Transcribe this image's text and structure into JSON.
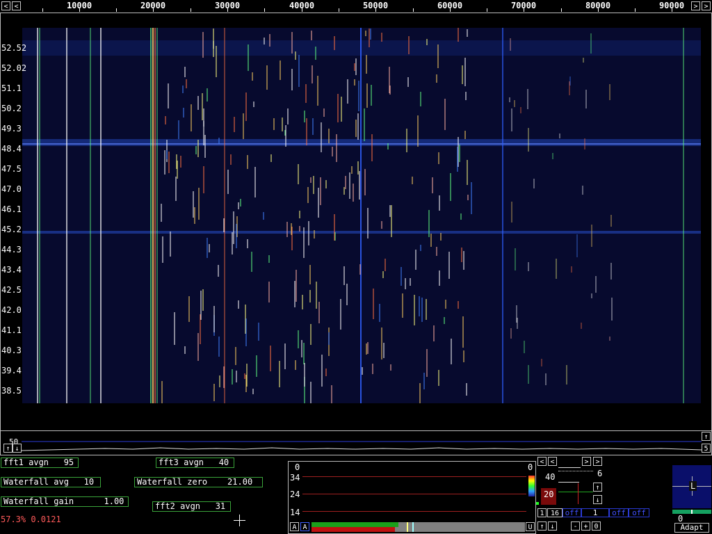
{
  "freq_axis": {
    "ticks": [
      "10000",
      "20000",
      "30000",
      "40000",
      "50000",
      "60000",
      "70000",
      "80000",
      "90000"
    ],
    "left_arrow": "<",
    "right_arrow": ">",
    "far_left_arrow": "<",
    "far_right_arrow": ">"
  },
  "waterfall": {
    "time_labels": [
      "52.52",
      "52.02",
      "51.1",
      "50.2",
      "49.3",
      "48.4",
      "47.5",
      "47.0",
      "46.1",
      "45.2",
      "44.3",
      "43.4",
      "42.5",
      "42.0",
      "41.1",
      "40.3",
      "39.4",
      "38.5"
    ],
    "colors": {
      "background": "#070a2e",
      "band": "#1f3fa8"
    }
  },
  "spectrum": {
    "level_label": "50",
    "up_arrow": "↑",
    "down_arrow": "↓",
    "right_value": "5"
  },
  "params": {
    "fft1_avgn": "fft1 avgn   95",
    "fft3_avgn": "fft3 avgn   40",
    "waterfall_avg": "Waterfall avg   10",
    "waterfall_zero": "Waterfall zero    21.00",
    "waterfall_gain": "Waterfall gain      1.00",
    "fft2_avgn": "fft2 avgn   31",
    "status": "57.3% 0.0121"
  },
  "smeter": {
    "top_left": "0",
    "top_right": "0",
    "levels": [
      "34",
      "24",
      "14"
    ],
    "btn_a1": "A",
    "btn_a2": "A",
    "btn_u": "U"
  },
  "control": {
    "left_arrow": "<",
    "left_arrow2": "<",
    "right_arrow": ">",
    "right_arrow2": ">",
    "value_40": "40",
    "value_6": "6",
    "value_20": "20",
    "up": "↑",
    "down": "↓",
    "btn_1": "1",
    "btn_16": "16",
    "off1": "off",
    "mid_val": "1",
    "off2": "off",
    "off3": "off",
    "up2": "↑",
    "down2": "↓",
    "minus": "-",
    "plus": "+",
    "zero": "0"
  },
  "mini": {
    "marker": "L",
    "value": "0",
    "adapt": "Adapt"
  }
}
